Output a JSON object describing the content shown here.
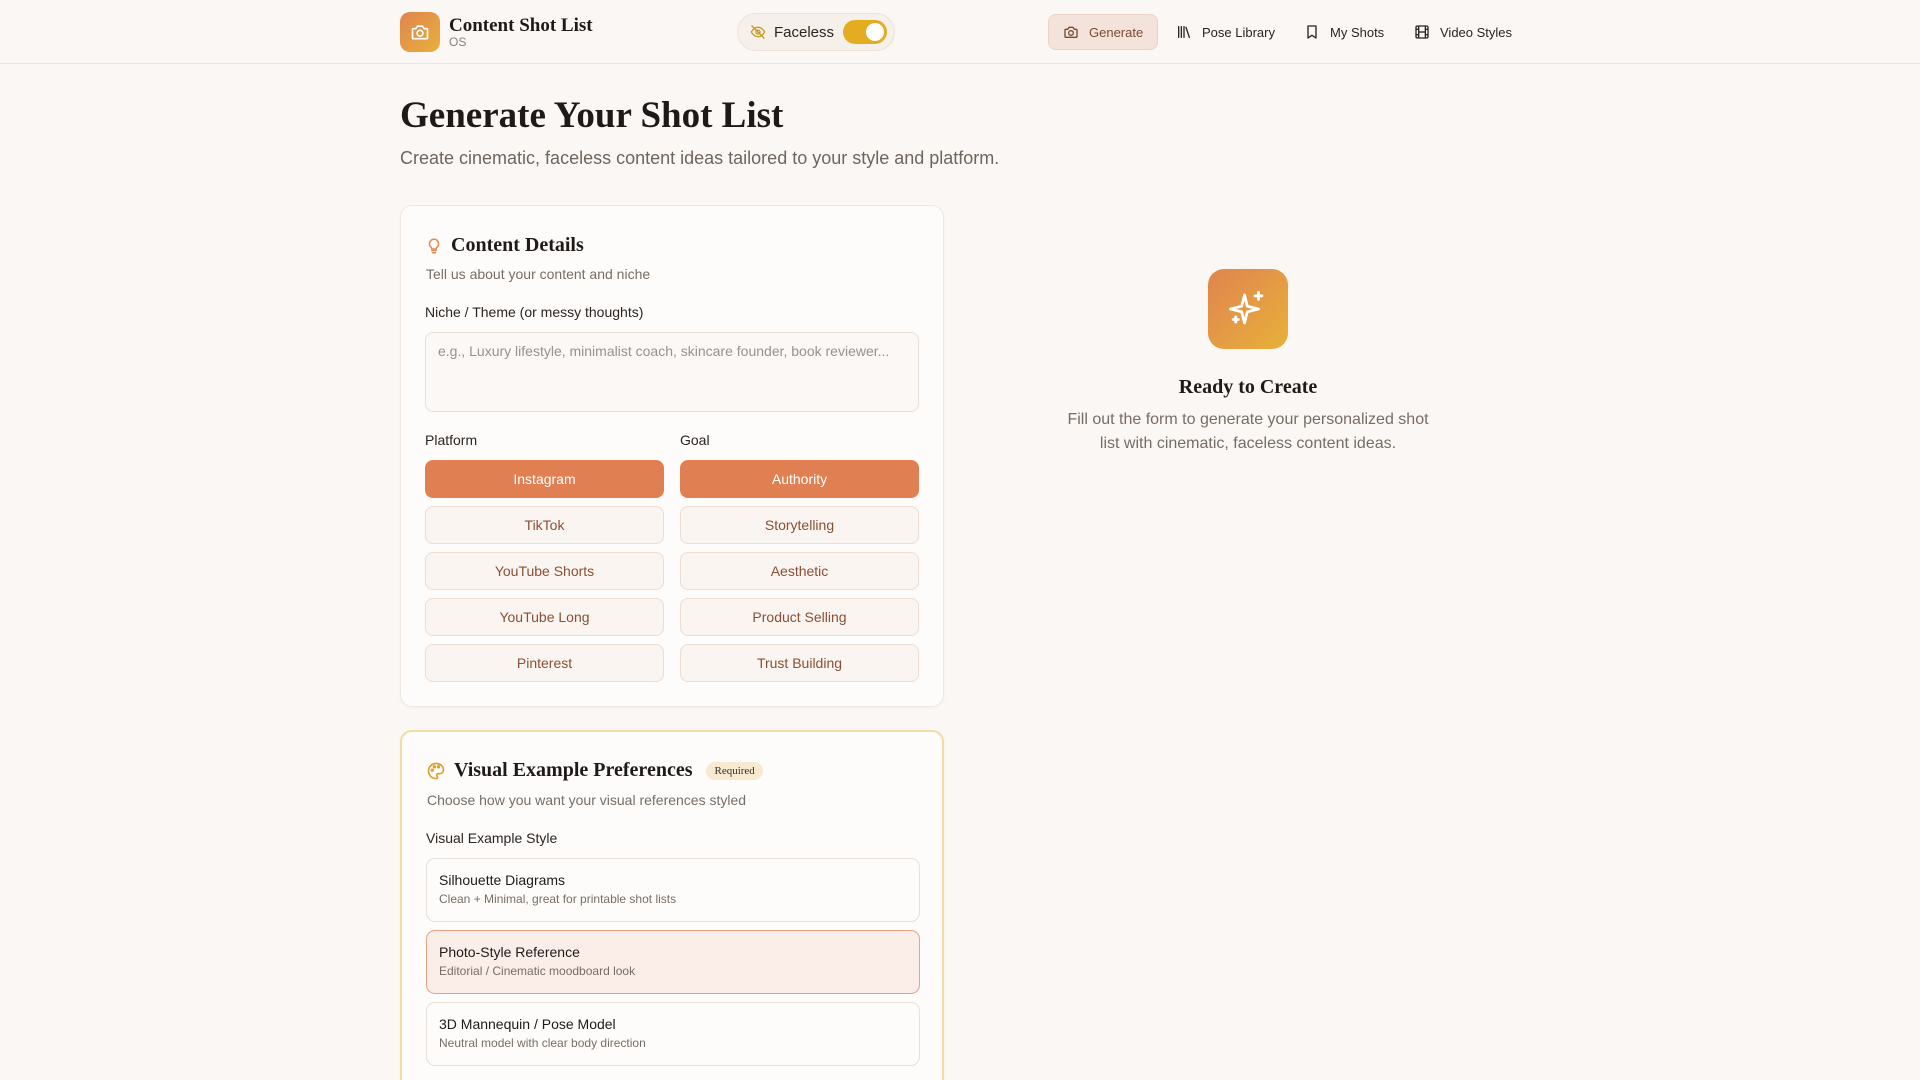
{
  "brand": {
    "title": "Content Shot List",
    "subtitle": "OS",
    "logo_icon": "camera-icon"
  },
  "header": {
    "faceless_label": "Faceless",
    "faceless_on": true,
    "nav": [
      {
        "label": "Generate",
        "icon": "camera-icon",
        "active": true
      },
      {
        "label": "Pose Library",
        "icon": "library-icon",
        "active": false
      },
      {
        "label": "My Shots",
        "icon": "bookmark-icon",
        "active": false
      },
      {
        "label": "Video Styles",
        "icon": "film-icon",
        "active": false
      }
    ]
  },
  "page": {
    "title": "Generate Your Shot List",
    "subtitle": "Create cinematic, faceless content ideas tailored to your style and platform."
  },
  "content_details": {
    "title": "Content Details",
    "description": "Tell us about your content and niche",
    "niche_label": "Niche / Theme (or messy thoughts)",
    "niche_value": "",
    "niche_placeholder": "e.g., Luxury lifestyle, minimalist coach, skincare founder, book reviewer...",
    "platform_label": "Platform",
    "platforms": [
      "Instagram",
      "TikTok",
      "YouTube Shorts",
      "YouTube Long",
      "Pinterest"
    ],
    "platform_selected": "Instagram",
    "goal_label": "Goal",
    "goals": [
      "Authority",
      "Storytelling",
      "Aesthetic",
      "Product Selling",
      "Trust Building"
    ],
    "goal_selected": "Authority"
  },
  "visual_prefs": {
    "title": "Visual Example Preferences",
    "badge": "Required",
    "description": "Choose how you want your visual references styled",
    "style_label": "Visual Example Style",
    "styles": [
      {
        "title": "Silhouette Diagrams",
        "desc": "Clean + Minimal, great for printable shot lists",
        "selected": false
      },
      {
        "title": "Photo-Style Reference",
        "desc": "Editorial / Cinematic moodboard look",
        "selected": true
      },
      {
        "title": "3D Mannequin / Pose Model",
        "desc": "Neutral model with clear body direction",
        "selected": false
      }
    ]
  },
  "empty_state": {
    "title": "Ready to Create",
    "description": "Fill out the form to generate your personalized shot list with cinematic, faceless content ideas.",
    "icon": "sparkles-icon"
  },
  "colors": {
    "accent": "#e07f51",
    "toggle": "#e5ac22",
    "background": "#faf7f4"
  }
}
